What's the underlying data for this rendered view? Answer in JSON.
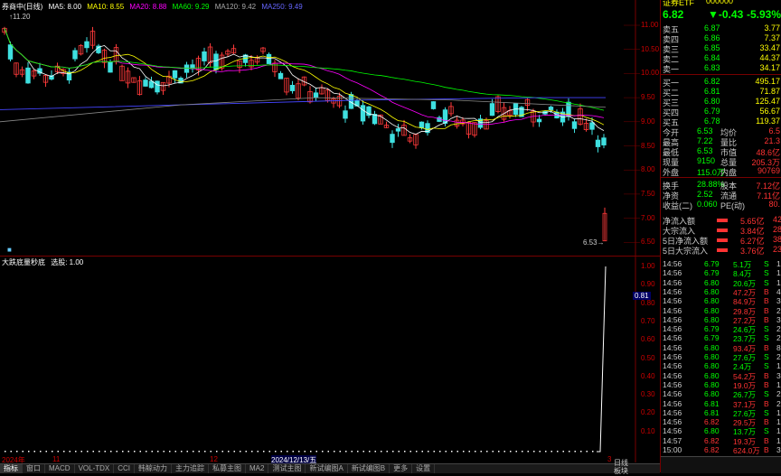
{
  "header": {
    "stock_name": "券商中(日线)",
    "ma5": "MA5: 8.00",
    "ma10": "MA10: 8.55",
    "ma20": "MA20: 8.88",
    "ma60": "MA60: 9.29",
    "ma120": "MA120: 9.42",
    "ma250": "MA250: 9.49",
    "colors": {
      "ma5": "#ffffff",
      "ma10": "#ffff00",
      "ma20": "#ff00ff",
      "ma60": "#00ff00",
      "ma120": "#6666ff",
      "ma250": "#4444ff"
    }
  },
  "price_axis": [
    "11.00",
    "10.50",
    "10.00",
    "9.50",
    "9.00",
    "8.50",
    "8.00",
    "7.50",
    "7.00",
    "6.50"
  ],
  "high_marker": "11.20",
  "low_marker": "6.53",
  "indicator": {
    "title": "大跌底量秒底",
    "label": "选股: 1.00",
    "axis": [
      "1.00",
      "0.90",
      "0.80",
      "0.70",
      "0.60",
      "0.50",
      "0.40",
      "0.30",
      "0.20",
      "0.10"
    ],
    "current_value": "0.81"
  },
  "date_axis": [
    "2024年",
    "11",
    "12",
    "2024/12/13/五",
    "3"
  ],
  "bottom_tabs": [
    "指标",
    "窗口",
    "MACD",
    "VOL-TDX",
    "CCI",
    "韩鲸动力",
    "主力追踪",
    "私募主图",
    "MA2",
    "测试主图",
    "新试编图A",
    "新试编图B",
    "更多",
    "设置"
  ],
  "stock_info": {
    "name": "证券ETF",
    "code": "000000",
    "price": "6.82",
    "change": "-0.43",
    "change_pct": "-5.93%"
  },
  "order_book": {
    "asks": [
      {
        "label": "卖五",
        "price": "6.87",
        "vol": "3.77"
      },
      {
        "label": "卖四",
        "price": "6.86",
        "vol": "7.37"
      },
      {
        "label": "卖三",
        "price": "6.85",
        "vol": "33.47"
      },
      {
        "label": "卖二",
        "price": "6.84",
        "vol": "44.37"
      },
      {
        "label": "卖一",
        "price": "6.83",
        "vol": "34.17"
      }
    ],
    "bids": [
      {
        "label": "买一",
        "price": "6.82",
        "vol": "495.17"
      },
      {
        "label": "买二",
        "price": "6.81",
        "vol": "71.87"
      },
      {
        "label": "买三",
        "price": "6.80",
        "vol": "125.47"
      },
      {
        "label": "买四",
        "price": "6.79",
        "vol": "56.67"
      },
      {
        "label": "买五",
        "price": "6.78",
        "vol": "119.37"
      }
    ]
  },
  "quote_stats": [
    {
      "l1": "今开",
      "v1": "6.53",
      "l2": "均价",
      "v2": "6.5"
    },
    {
      "l1": "最高",
      "v1": "7.22",
      "l2": "量比",
      "v2": "21.3"
    },
    {
      "l1": "最低",
      "v1": "6.53",
      "l2": "市值",
      "v2": "48.6亿"
    },
    {
      "l1": "现量",
      "v1": "9150",
      "l2": "总量",
      "v2": "205.3万"
    },
    {
      "l1": "外盘",
      "v1": "115.0万",
      "l2": "内盘",
      "v2": "90769"
    }
  ],
  "quote_stats2": [
    {
      "l1": "换手",
      "v1": "28.88%",
      "l2": "股本",
      "v2": "7.12亿"
    },
    {
      "l1": "净资",
      "v1": "2.52",
      "l2": "流通",
      "v2": "7.11亿"
    },
    {
      "l1": "收益(二)",
      "v1": "0.060",
      "l2": "PE(动)",
      "v2": "80."
    }
  ],
  "fund_flow": [
    {
      "label": "净流入额",
      "value": "5.65亿",
      "extra": "42"
    },
    {
      "label": "大宗流入",
      "value": "3.84亿",
      "extra": "28"
    },
    {
      "label": "5日净流入额",
      "value": "6.27亿",
      "extra": "38"
    },
    {
      "label": "5日大宗流入",
      "value": "3.76亿",
      "extra": "23"
    }
  ],
  "trades": [
    {
      "t": "14:56",
      "p": "6.79",
      "v": "5.1万",
      "s": "S",
      "n": "1"
    },
    {
      "t": "14:56",
      "p": "6.79",
      "v": "8.4万",
      "s": "S",
      "n": "1"
    },
    {
      "t": "14:56",
      "p": "6.80",
      "v": "20.6万",
      "s": "S",
      "n": "1"
    },
    {
      "t": "14:56",
      "p": "6.80",
      "v": "47.2万",
      "s": "B",
      "n": "4"
    },
    {
      "t": "14:56",
      "p": "6.80",
      "v": "84.9万",
      "s": "B",
      "n": "3"
    },
    {
      "t": "14:56",
      "p": "6.80",
      "v": "29.8万",
      "s": "B",
      "n": "2"
    },
    {
      "t": "14:56",
      "p": "6.80",
      "v": "27.2万",
      "s": "B",
      "n": "3"
    },
    {
      "t": "14:56",
      "p": "6.79",
      "v": "24.6万",
      "s": "S",
      "n": "2"
    },
    {
      "t": "14:56",
      "p": "6.79",
      "v": "23.7万",
      "s": "S",
      "n": "2"
    },
    {
      "t": "14:56",
      "p": "6.80",
      "v": "93.4万",
      "s": "B",
      "n": "8"
    },
    {
      "t": "14:56",
      "p": "6.80",
      "v": "27.6万",
      "s": "S",
      "n": "2"
    },
    {
      "t": "14:56",
      "p": "6.80",
      "v": "2.4万",
      "s": "S",
      "n": "1"
    },
    {
      "t": "14:56",
      "p": "6.80",
      "v": "54.2万",
      "s": "B",
      "n": "3"
    },
    {
      "t": "14:56",
      "p": "6.80",
      "v": "19.0万",
      "s": "B",
      "n": "1"
    },
    {
      "t": "14:56",
      "p": "6.80",
      "v": "26.7万",
      "s": "S",
      "n": "2"
    },
    {
      "t": "14:56",
      "p": "6.81",
      "v": "37.1万",
      "s": "B",
      "n": "2"
    },
    {
      "t": "14:56",
      "p": "6.81",
      "v": "27.6万",
      "s": "S",
      "n": "1"
    },
    {
      "t": "14:56",
      "p": "6.82",
      "v": "29.5万",
      "s": "B",
      "n": "1"
    },
    {
      "t": "14:56",
      "p": "6.80",
      "v": "13.7万",
      "s": "S",
      "n": "1"
    },
    {
      "t": "14:57",
      "p": "6.82",
      "v": "19.3万",
      "s": "B",
      "n": "1"
    },
    {
      "t": "15:00",
      "p": "6.82",
      "v": "624.0万",
      "s": "B",
      "n": "3"
    }
  ],
  "bottom_right": {
    "tab1": "日线",
    "tab2": "板块"
  }
}
